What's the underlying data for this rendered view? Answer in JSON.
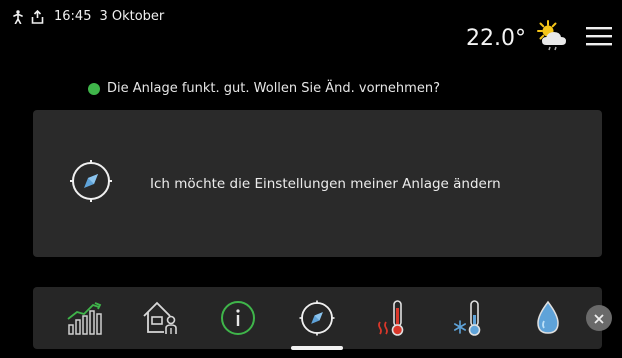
{
  "status_bar": {
    "time": "16:45",
    "date": "3 Oktober",
    "temperature": "22.0°",
    "weather_icon": "partly-cloudy-drizzle-icon"
  },
  "status_message": {
    "text": "Die Anlage funkt. gut. Wollen Sie Änd. vornehmen?",
    "indicator_color": "#3fb54a"
  },
  "main_card": {
    "label": "Ich möchte die Einstellungen meiner Anlage ändern",
    "icon": "compass-icon"
  },
  "bottom_nav": {
    "items": [
      {
        "icon": "energy-statistics-icon"
      },
      {
        "icon": "house-user-icon"
      },
      {
        "icon": "info-icon",
        "color": "#3fb54a"
      },
      {
        "icon": "compass-icon",
        "active": true
      },
      {
        "icon": "heating-thermometer-icon",
        "color": "#d9372a"
      },
      {
        "icon": "cooling-thermometer-icon"
      },
      {
        "icon": "hot-water-drop-icon"
      }
    ],
    "close_icon": "close-icon"
  },
  "colors": {
    "background": "#000000",
    "card": "#2a2a2a",
    "accent_green": "#3fb54a",
    "accent_red": "#d9372a",
    "sun_yellow": "#f5c518"
  }
}
